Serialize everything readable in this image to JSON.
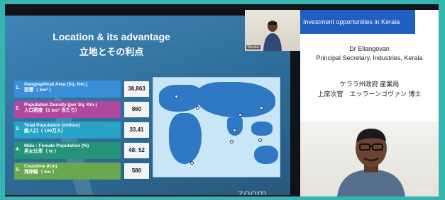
{
  "slide": {
    "title_en": "Location & its advantage",
    "title_ja": "立地とその利点",
    "stats": [
      {
        "num": "1.",
        "label_en": "Geographical Area (Sq. Km.)",
        "label_ja": "面積（ km² ）",
        "value": "38,863",
        "color": "#3a8fd8"
      },
      {
        "num": "2.",
        "label_en": "Population Density (per Sq. Km.)",
        "label_ja": "人口密度（1 km² 当たり）",
        "value": "860",
        "color": "#b0489e"
      },
      {
        "num": "3.",
        "label_en": "Total Population (million)",
        "label_ja": "総人口（ 100万人）",
        "value": "33.41",
        "color": "#2aa3c9"
      },
      {
        "num": "4.",
        "label_en": "Male : Female Population (%)",
        "label_ja": "男女比率（ % ）",
        "value": "48: 52",
        "color": "#23947a"
      },
      {
        "num": "5.",
        "label_en": "Coastline (Km)",
        "label_ja": "海岸線（ km ）",
        "value": "580",
        "color": "#6aa84f"
      }
    ],
    "watermark": "zoom"
  },
  "small_cam": {
    "name": "Kerala"
  },
  "info": {
    "header": "Investment opportunities in Kerala",
    "name_en": "Dr Ellangovan",
    "role_en": "Principal Secretary, Industries, Kerala",
    "org_ja": "ケララ州政府 産業局",
    "role_ja": "上席次官　エッラーンゴヴァン 博士"
  },
  "big_cam": {
    "watermark": "zoom"
  }
}
